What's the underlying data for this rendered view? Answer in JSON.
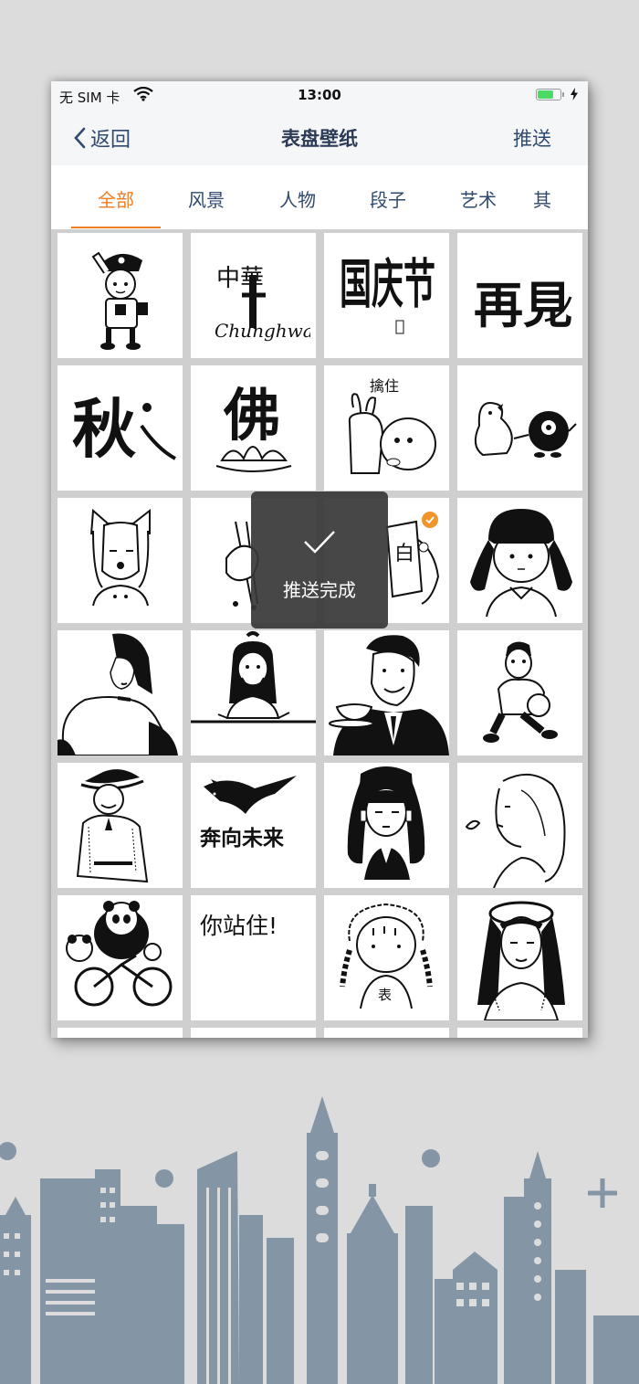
{
  "status_bar": {
    "carrier": "无 SIM 卡",
    "time": "13:00",
    "battery_level": 0.75,
    "battery_color": "#4cd964"
  },
  "nav": {
    "back_label": "返回",
    "title": "表盘壁纸",
    "push_label": "推送"
  },
  "tabs": [
    {
      "label": "全部",
      "active": true
    },
    {
      "label": "风景",
      "active": false
    },
    {
      "label": "人物",
      "active": false
    },
    {
      "label": "段子",
      "active": false
    },
    {
      "label": "艺术",
      "active": false
    },
    {
      "label": "其",
      "active": false
    }
  ],
  "wallpapers": [
    {
      "icon": "police-boy-cartoon-icon"
    },
    {
      "icon": "chunghwa-calligraphy-icon",
      "text": "中華",
      "caption": "Chunghwa"
    },
    {
      "icon": "national-day-calligraphy-icon",
      "text": "国庆节"
    },
    {
      "icon": "goodbye-calligraphy-icon",
      "text": "再見"
    },
    {
      "icon": "autumn-calligraphy-icon",
      "text": "秋"
    },
    {
      "icon": "buddha-lotus-calligraphy-icon",
      "text": "佛"
    },
    {
      "icon": "rabbit-hug-cartoon-icon",
      "text": "擒住"
    },
    {
      "icon": "bird-creatures-cartoon-icon"
    },
    {
      "icon": "cat-ears-girl-icon"
    },
    {
      "icon": "chopsticks-hand-icon"
    },
    {
      "icon": "hand-card-icon",
      "text": "白",
      "selected": true
    },
    {
      "icon": "pigtail-girl-icon"
    },
    {
      "icon": "fashion-girl-icon"
    },
    {
      "icon": "girl-at-table-icon"
    },
    {
      "icon": "retro-man-teacup-icon"
    },
    {
      "icon": "basketball-player-icon"
    },
    {
      "icon": "cowboy-icon"
    },
    {
      "icon": "running-wolf-icon",
      "text": "奔向未来"
    },
    {
      "icon": "twin-tails-girl-icon"
    },
    {
      "icon": "sketch-girl-profile-icon"
    },
    {
      "icon": "panda-bicycle-icon"
    },
    {
      "icon": "hold-on-text-icon",
      "text": "你站住!"
    },
    {
      "icon": "braided-girl-icon",
      "text": "表"
    },
    {
      "icon": "beret-girl-icon"
    }
  ],
  "toast": {
    "label": "推送完成",
    "icon": "checkmark-icon"
  },
  "colors": {
    "accent": "#ee7d22",
    "nav_text": "#2f4a6e",
    "badge": "#f0952c",
    "city_silhouette": "#8496a6"
  }
}
